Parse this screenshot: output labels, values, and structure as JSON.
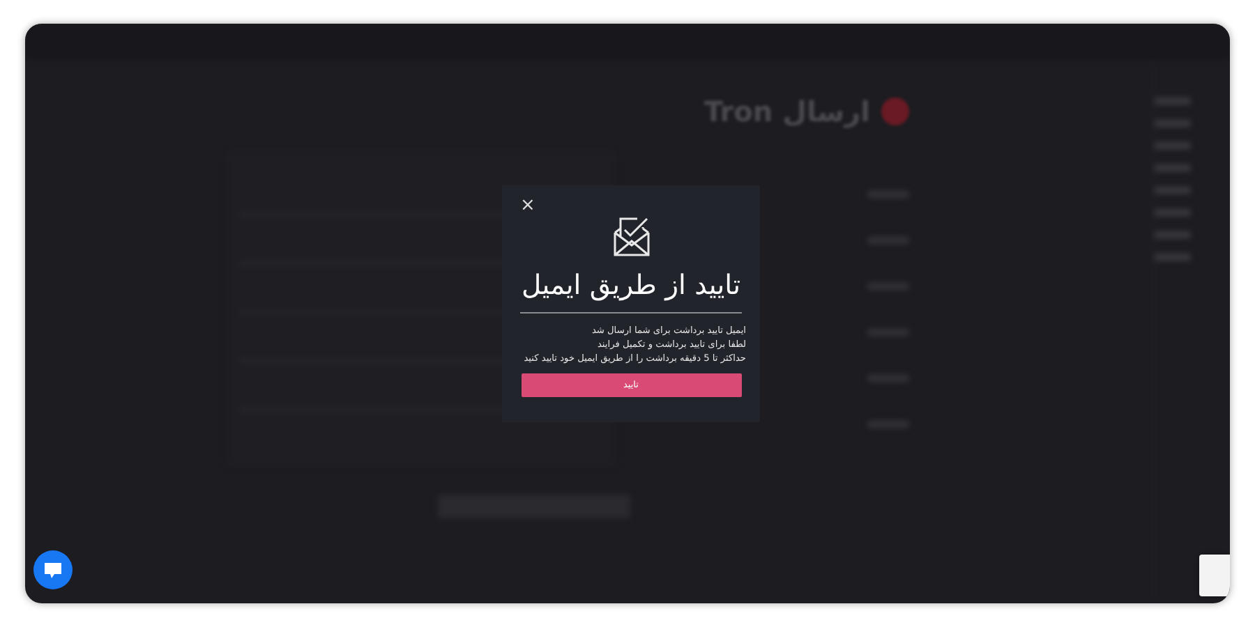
{
  "page": {
    "title": "ارسال Tron"
  },
  "modal": {
    "close": "×",
    "title": "تایید از طریق ایمیل",
    "lines": [
      "ایمیل تایید برداشت برای شما ارسال شد",
      "لطفا برای تایید برداشت و تکمیل فرایند",
      "حداکثر تا 5 دقیقه برداشت را از طریق ایمیل خود تایید کنید"
    ],
    "button": "تایید"
  }
}
